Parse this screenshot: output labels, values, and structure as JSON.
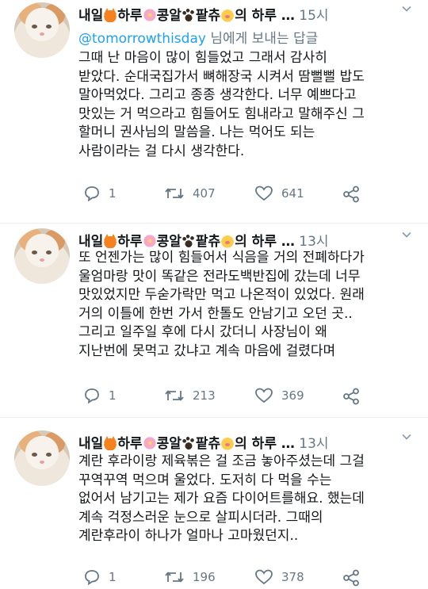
{
  "author": {
    "name_parts": [
      "내일",
      "하루",
      "콩알",
      "팥츄",
      "의 하루 …"
    ],
    "name_emojis": [
      "fox-emoji",
      "flower-emoji",
      "paw-emoji",
      "baby-emoji"
    ]
  },
  "tweets": [
    {
      "time": "15시",
      "reply_handle": "@tomorrowthisday",
      "reply_suffix": " 님에게 보내는 답글",
      "lines": [
        "그때 난 마음이 많이 힘들었고 그래서 감사히",
        "받았다. 순대국집가서 뼈해장국 시켜서 땀뻘뻘 밥도",
        "말아먹었다. 그리고 종종 생각한다. 너무 예쁘다고",
        "맛있는 거 먹으라고 힘들어도 힘내라고 말해주신 그",
        "할머니 권사님의 말씀을. 나는 먹어도 되는",
        "사람이라는 걸 다시 생각한다."
      ],
      "replies": "1",
      "retweets": "407",
      "likes": "641"
    },
    {
      "time": "13시",
      "lines": [
        "또 언젠가는 많이 힘들어서 식음을 거의 전폐하다가",
        "울엄마랑 맛이 똑같은 전라도백반집에 갔는데 너무",
        "맛있었지만 두숟가락만 먹고 나온적이 있었다. 원래",
        "거의 이틀에 한번 가서 한톨도 안남기고 오던 곳..",
        "그리고 일주일 후에 다시 갔더니 사장님이 왜",
        "지난번에 못먹고 갔냐고 계속 마음에 걸렸다며"
      ],
      "replies": "1",
      "retweets": "213",
      "likes": "369"
    },
    {
      "time": "13시",
      "lines": [
        "계란 후라이랑 제육볶은 걸 조금 놓아주셨는데 그걸",
        "꾸역꾸역 먹으며 울었다. 도저히 다 먹을 수는",
        "없어서 남기고는 제가 요즘 다이어트를해요. 했는데",
        "계속 걱정스러운 눈으로 살피시더라. 그때의",
        "계란후라이 하나가 얼마나 고마웠던지.."
      ],
      "replies": "1",
      "retweets": "196",
      "likes": "378"
    }
  ],
  "colors": {
    "link": "#1da1f2",
    "muted": "#657786",
    "divider": "#e6ecf0",
    "text": "#14171a"
  }
}
